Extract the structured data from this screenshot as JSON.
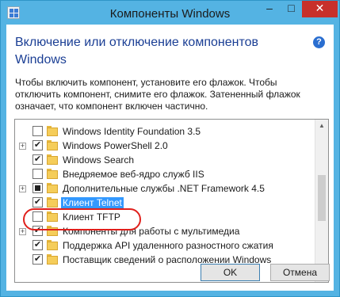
{
  "window": {
    "title": "Компоненты Windows",
    "minimize": "–",
    "maximize": "□",
    "close": "✕"
  },
  "heading": "Включение или отключение компонентов Windows",
  "help": "?",
  "description": "Чтобы включить компонент, установите его флажок. Чтобы отключить компонент, снимите его флажок. Затененный флажок означает, что компонент включен частично.",
  "components": [
    {
      "label": "Windows Identity Foundation 3.5",
      "state": "unchecked",
      "expandable": false,
      "selected": false
    },
    {
      "label": "Windows PowerShell 2.0",
      "state": "checked",
      "expandable": true,
      "selected": false
    },
    {
      "label": "Windows Search",
      "state": "checked",
      "expandable": false,
      "selected": false
    },
    {
      "label": "Внедряемое веб-ядро служб IIS",
      "state": "unchecked",
      "expandable": false,
      "selected": false
    },
    {
      "label": "Дополнительные службы .NET Framework 4.5",
      "state": "partial",
      "expandable": true,
      "selected": false
    },
    {
      "label": "Клиент Telnet",
      "state": "checked",
      "expandable": false,
      "selected": true
    },
    {
      "label": "Клиент TFTP",
      "state": "unchecked",
      "expandable": false,
      "selected": false
    },
    {
      "label": "Компоненты для работы с мультимедиа",
      "state": "checked",
      "expandable": true,
      "selected": false
    },
    {
      "label": "Поддержка API удаленного разностного сжатия",
      "state": "checked",
      "expandable": false,
      "selected": false
    },
    {
      "label": "Поставщик сведений о расположении Windows",
      "state": "checked",
      "expandable": false,
      "selected": false
    }
  ],
  "scrollbar": {
    "up": "▲",
    "down": "▼"
  },
  "buttons": {
    "ok": "OK",
    "cancel": "Отмена"
  }
}
